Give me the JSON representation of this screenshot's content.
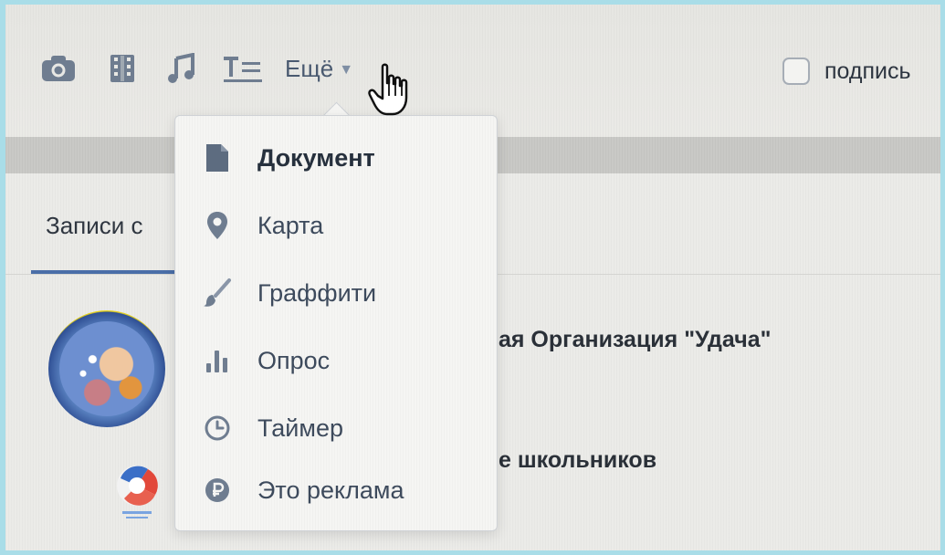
{
  "toolbar": {
    "icons": [
      "camera-icon",
      "video-icon",
      "music-icon",
      "text-format-icon"
    ],
    "more_label": "Ещё",
    "signature_label": "подпись",
    "signature_checked": false
  },
  "feed": {
    "tab_label": "Записи с",
    "posts": [
      {
        "title": "ая Организация \"Удача\""
      },
      {
        "title": "е школьников"
      }
    ]
  },
  "dropdown": {
    "items": [
      {
        "label": "Документ",
        "icon": "document-icon"
      },
      {
        "label": "Карта",
        "icon": "map-pin-icon"
      },
      {
        "label": "Граффити",
        "icon": "brush-icon"
      },
      {
        "label": "Опрос",
        "icon": "poll-icon"
      },
      {
        "label": "Таймер",
        "icon": "clock-icon"
      },
      {
        "label": "Это реклама",
        "icon": "ruble-icon"
      }
    ]
  },
  "colors": {
    "icon": "#6f7d90",
    "accent": "#4a6ea8",
    "text": "#3d4a5c"
  }
}
